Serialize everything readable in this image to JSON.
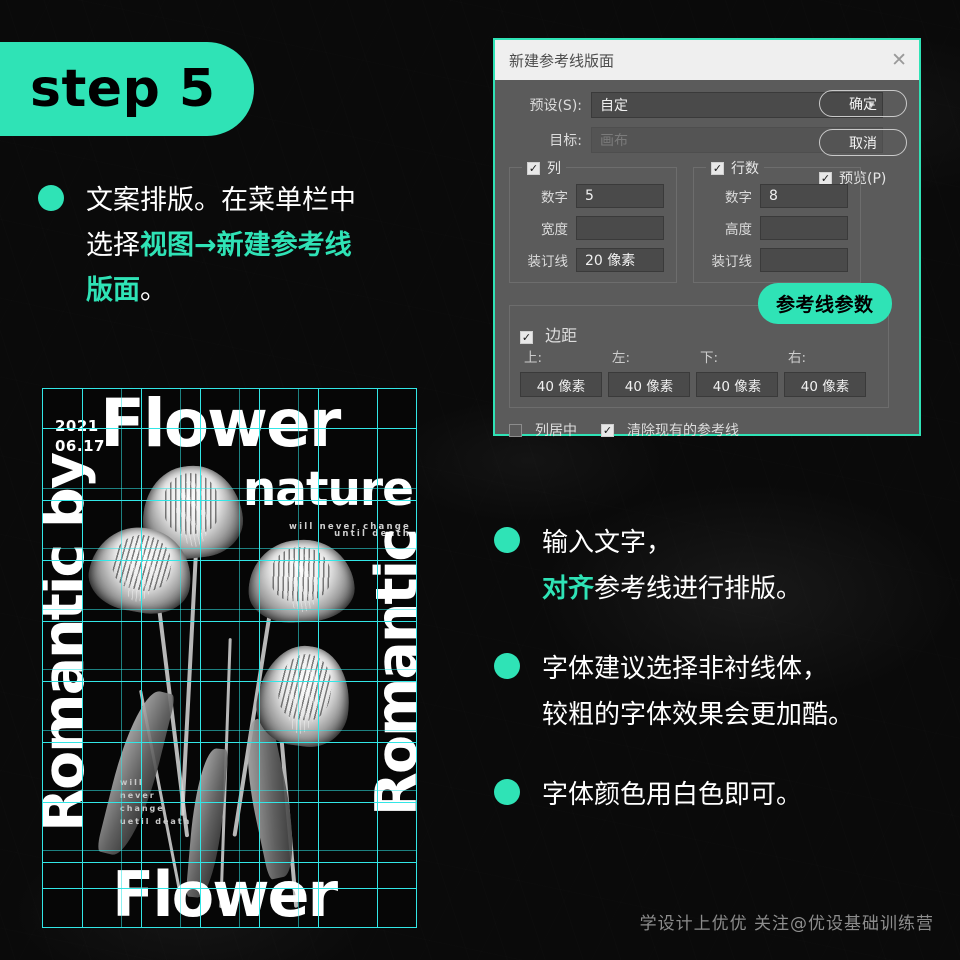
{
  "theme": {
    "accent": "#2FE3B6",
    "guide": "#32E6E6",
    "background": "#0a0a0a",
    "dialog_bg": "#5b5b5b"
  },
  "step_badge": {
    "label": "step 5"
  },
  "left_instruction": {
    "line1": "文案排版。在菜单栏中",
    "line2_prefix": "选择",
    "line2_accent": "视图→新建参考线",
    "line3_accent": "版面",
    "line3_suffix": "。"
  },
  "poster": {
    "date": "2021\n06.17",
    "title_top": "Flower",
    "title_nature": "nature",
    "sub_top": "will never change\nuntil death",
    "vertical_left": "Romantic by",
    "vertical_right": "Romantic",
    "sub_bottom": "will\nnever\nchange\nuetil death",
    "title_bottom": "Flower"
  },
  "dialog": {
    "title": "新建参考线版面",
    "close_icon": "close-icon",
    "preset_label": "预设(S):",
    "preset_value": "自定",
    "target_label": "目标:",
    "target_value": "画布",
    "ok_label": "确定",
    "cancel_label": "取消",
    "preview_label": "预览(P)",
    "preview_checked": true,
    "columns": {
      "legend": "列",
      "checked": true,
      "number_label": "数字",
      "number_value": "5",
      "width_label": "宽度",
      "width_value": "",
      "gutter_label": "装订线",
      "gutter_value": "20 像素"
    },
    "rows": {
      "legend": "行数",
      "checked": true,
      "number_label": "数字",
      "number_value": "8",
      "height_label": "高度",
      "height_value": "",
      "gutter_label": "装订线",
      "gutter_value": ""
    },
    "margin": {
      "legend": "边距",
      "checked": true,
      "labels": [
        "上:",
        "左:",
        "下:",
        "右:"
      ],
      "values": [
        "40 像素",
        "40 像素",
        "40 像素",
        "40 像素"
      ]
    },
    "center_columns_label": "列居中",
    "center_columns_checked": false,
    "clear_guides_label": "清除现有的参考线",
    "clear_guides_checked": true
  },
  "callout": {
    "label": "参考线参数"
  },
  "right_list": {
    "items": [
      {
        "line1": "输入文字，",
        "line2_accent": "对齐",
        "line2_rest": "参考线进行排版。"
      },
      {
        "line1": "字体建议选择非衬线体，",
        "line2_accent": "",
        "line2_rest": "较粗的字体效果会更加酷。"
      },
      {
        "line1": "字体颜色用白色即可。",
        "line2_accent": "",
        "line2_rest": ""
      }
    ]
  },
  "footer": {
    "text": "学设计上优优  关注@优设基础训练营"
  }
}
